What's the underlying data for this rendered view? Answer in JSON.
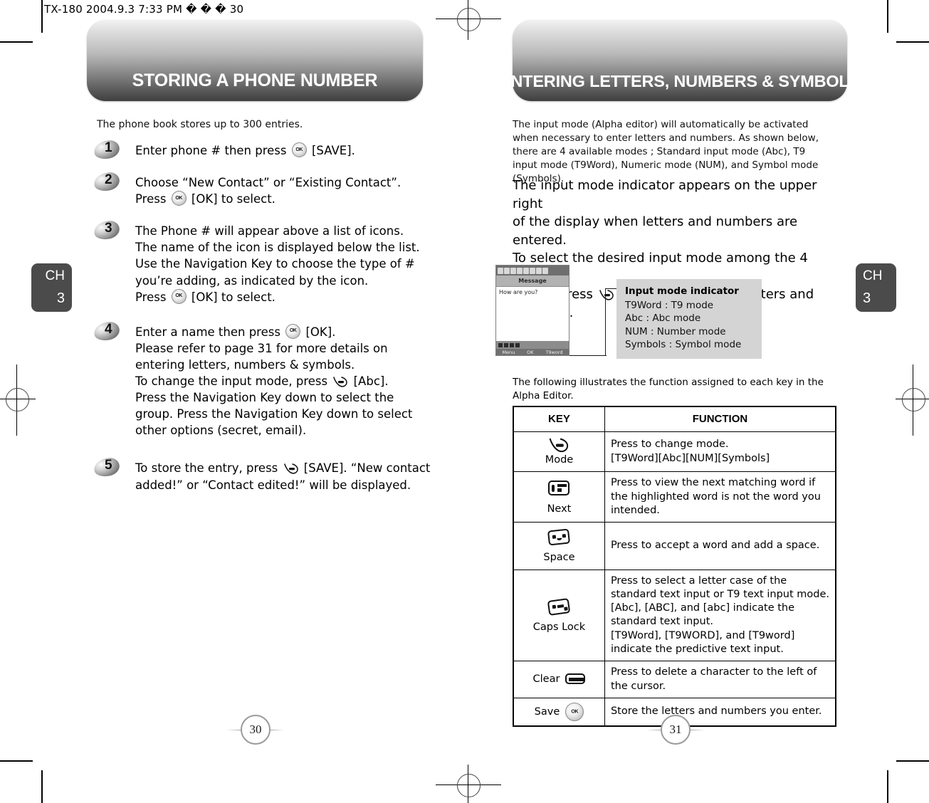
{
  "print_header": {
    "text": "TX-180  2004.9.3 7:33 PM  � � � 30"
  },
  "left_page": {
    "banner_title": "STORING A PHONE NUMBER",
    "page_number": "30",
    "chapter_tab": {
      "ch": "CH",
      "number": "3"
    },
    "intro": "The phone book stores up to 300 entries.",
    "steps": [
      {
        "number": "1",
        "lines": [
          {
            "parts": [
              {
                "t": "text",
                "v": "Enter phone # then press "
              },
              {
                "t": "key-ok"
              },
              {
                "t": "text",
                "v": " [SAVE]."
              }
            ]
          }
        ]
      },
      {
        "number": "2",
        "lines": [
          {
            "parts": [
              {
                "t": "text",
                "v": "Choose “New Contact” or “Existing Contact”."
              }
            ]
          },
          {
            "parts": [
              {
                "t": "text",
                "v": "Press "
              },
              {
                "t": "key-ok"
              },
              {
                "t": "text",
                "v": " [OK] to select."
              }
            ]
          }
        ]
      },
      {
        "number": "3",
        "lines": [
          {
            "parts": [
              {
                "t": "text",
                "v": "The Phone # will appear above a list of icons."
              }
            ]
          },
          {
            "parts": [
              {
                "t": "text",
                "v": "The name of the icon is displayed below the list."
              }
            ]
          },
          {
            "parts": [
              {
                "t": "text",
                "v": "Use the Navigation Key to choose the type of #"
              }
            ]
          },
          {
            "parts": [
              {
                "t": "text",
                "v": "you’re adding, as indicated by the icon."
              }
            ]
          },
          {
            "parts": [
              {
                "t": "text",
                "v": "Press "
              },
              {
                "t": "key-ok"
              },
              {
                "t": "text",
                "v": " [OK] to select."
              }
            ]
          }
        ]
      },
      {
        "number": "4",
        "lines": [
          {
            "parts": [
              {
                "t": "text",
                "v": "Enter a name then press "
              },
              {
                "t": "key-ok"
              },
              {
                "t": "text",
                "v": " [OK]."
              }
            ]
          },
          {
            "parts": [
              {
                "t": "text",
                "v": "Please refer to page 31 for more details on"
              }
            ]
          },
          {
            "parts": [
              {
                "t": "text",
                "v": "entering letters, numbers & symbols."
              }
            ]
          },
          {
            "parts": [
              {
                "t": "text",
                "v": "To change the input mode, press "
              },
              {
                "t": "key-soft"
              },
              {
                "t": "text",
                "v": " [Abc]."
              }
            ]
          },
          {
            "parts": [
              {
                "t": "text",
                "v": "Press the Navigation Key down to select the"
              }
            ]
          },
          {
            "parts": [
              {
                "t": "text",
                "v": "group. Press the Navigation Key down to select"
              }
            ]
          },
          {
            "parts": [
              {
                "t": "text",
                "v": "other options (secret, email)."
              }
            ]
          }
        ]
      },
      {
        "number": "5",
        "lines": [
          {
            "parts": [
              {
                "t": "text",
                "v": "To store the entry, press "
              },
              {
                "t": "key-soft"
              },
              {
                "t": "text",
                "v": " [SAVE]. “New contact"
              }
            ]
          },
          {
            "parts": [
              {
                "t": "text",
                "v": "added!” or “Contact edited!” will be displayed."
              }
            ]
          }
        ]
      }
    ]
  },
  "right_page": {
    "banner_title": "ENTERING LETTERS, NUMBERS & SYMBOLS",
    "page_number": "31",
    "chapter_tab": {
      "ch": "CH",
      "number": "3"
    },
    "paragraph_small": "The input mode (Alpha editor) will automatically be activated when necessary to enter letters and numbers. As shown below, there are 4 available modes ; Standard input mode (Abc), T9 input mode (T9Word), Numeric mode (NUM), and Symbol mode (Symbols).",
    "paragraph_large_lines": [
      "The input mode indicator appears on the upper right",
      "of the display when letters and numbers are entered.",
      "To select the desired input mode among the 4 modes",
      "below, press  [MODE], then enter letters and",
      "numbers."
    ],
    "phone_shot": {
      "title": "Message",
      "body_line1": "How are you?",
      "body_line2": "",
      "soft_left": "Menu",
      "soft_mid": "OK",
      "soft_right": "T9word"
    },
    "indicator_box": {
      "title": "Input mode indicator",
      "rows": [
        "T9Word : T9 mode",
        "Abc : Abc mode",
        "NUM : Number mode",
        "Symbols : Symbol mode"
      ]
    },
    "table_intro": "The following illustrates the function assigned to each key in the Alpha Editor.",
    "table": {
      "headers": [
        "KEY",
        "FUNCTION"
      ],
      "rows": [
        {
          "key_label": "Mode",
          "key_icon": "softkey-icon",
          "key_layout": "stacked",
          "function_lines": [
            "Press to change mode.",
            "[T9Word][Abc][NUM][Symbols]"
          ]
        },
        {
          "key_label": "Next",
          "key_icon": "padkey-next-icon",
          "key_layout": "stacked",
          "function_lines": [
            "Press to view the next matching word if",
            "the highlighted word is not the word you",
            "intended."
          ]
        },
        {
          "key_label": "Space",
          "key_icon": "padkey-space-icon",
          "key_layout": "stacked",
          "function_lines": [
            "Press to accept a word and add a space."
          ]
        },
        {
          "key_label": "Caps Lock",
          "key_icon": "padkey-caps-icon",
          "key_layout": "stacked",
          "function_lines": [
            "Press to select a letter case of the",
            "standard text input or T9 text input mode.",
            "[Abc], [ABC], and [abc] indicate the",
            "standard text input.",
            "[T9Word], [T9WORD], and [T9word]",
            "indicate the predictive text input."
          ]
        },
        {
          "key_label": "Clear",
          "key_icon": "padkey-clear-icon",
          "key_layout": "inline",
          "function_lines": [
            "Press to delete a character to the left of",
            "the cursor."
          ]
        },
        {
          "key_label": "Save",
          "key_icon": "ok-key-icon",
          "key_layout": "inline",
          "function_lines": [
            "Store the letters and numbers you enter."
          ]
        }
      ]
    }
  },
  "colors": {
    "banner_dark": "#3f3f3f",
    "banner_light": "#f2f2f2",
    "tab_gray": "#4b4b4b",
    "indicator_bg": "#d4d4d4"
  }
}
